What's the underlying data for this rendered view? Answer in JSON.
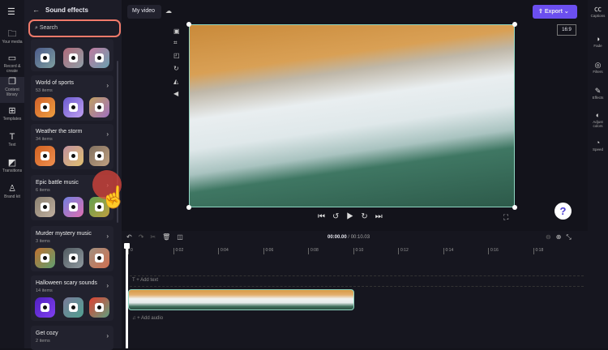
{
  "nav": {
    "items": [
      {
        "label": "Your media",
        "icon": "folder-icon"
      },
      {
        "label": "Record & create",
        "icon": "camera-icon"
      },
      {
        "label": "Content library",
        "icon": "library-icon"
      },
      {
        "label": "Templates",
        "icon": "grid-icon"
      },
      {
        "label": "Text",
        "icon": "text-icon"
      },
      {
        "label": "Transitions",
        "icon": "transitions-icon"
      },
      {
        "label": "Brand kit",
        "icon": "brand-icon"
      }
    ]
  },
  "panel": {
    "title": "Sound effects",
    "search_placeholder": "Search",
    "categories": [
      {
        "title": "World of sports",
        "count": "53 items"
      },
      {
        "title": "Weather the storm",
        "count": "34 items"
      },
      {
        "title": "Epic battle music",
        "count": "6 items"
      },
      {
        "title": "Murder mystery music",
        "count": "3 items"
      },
      {
        "title": "Halloween scary sounds",
        "count": "14 items"
      },
      {
        "title": "Get cozy",
        "count": "2 items"
      }
    ]
  },
  "header": {
    "tab": "My video",
    "export": "Export",
    "aspect": "16:9"
  },
  "timeline": {
    "time_current": "00:00.00",
    "time_total": "/ 00:10.03",
    "ticks": [
      "0",
      "0:02",
      "0:04",
      "0:06",
      "0:08",
      "0:10",
      "0:12",
      "0:14",
      "0:16",
      "0:18"
    ],
    "add_text": "+ Add text",
    "add_audio": "+ Add audio"
  },
  "right": {
    "items": [
      "Captions",
      "Fade",
      "Filters",
      "Effects",
      "Adjust colors",
      "Speed"
    ]
  },
  "colors": {
    "accent": "#6b4ff0",
    "highlight": "#f07a6a",
    "clip": "#8fd6c2"
  }
}
